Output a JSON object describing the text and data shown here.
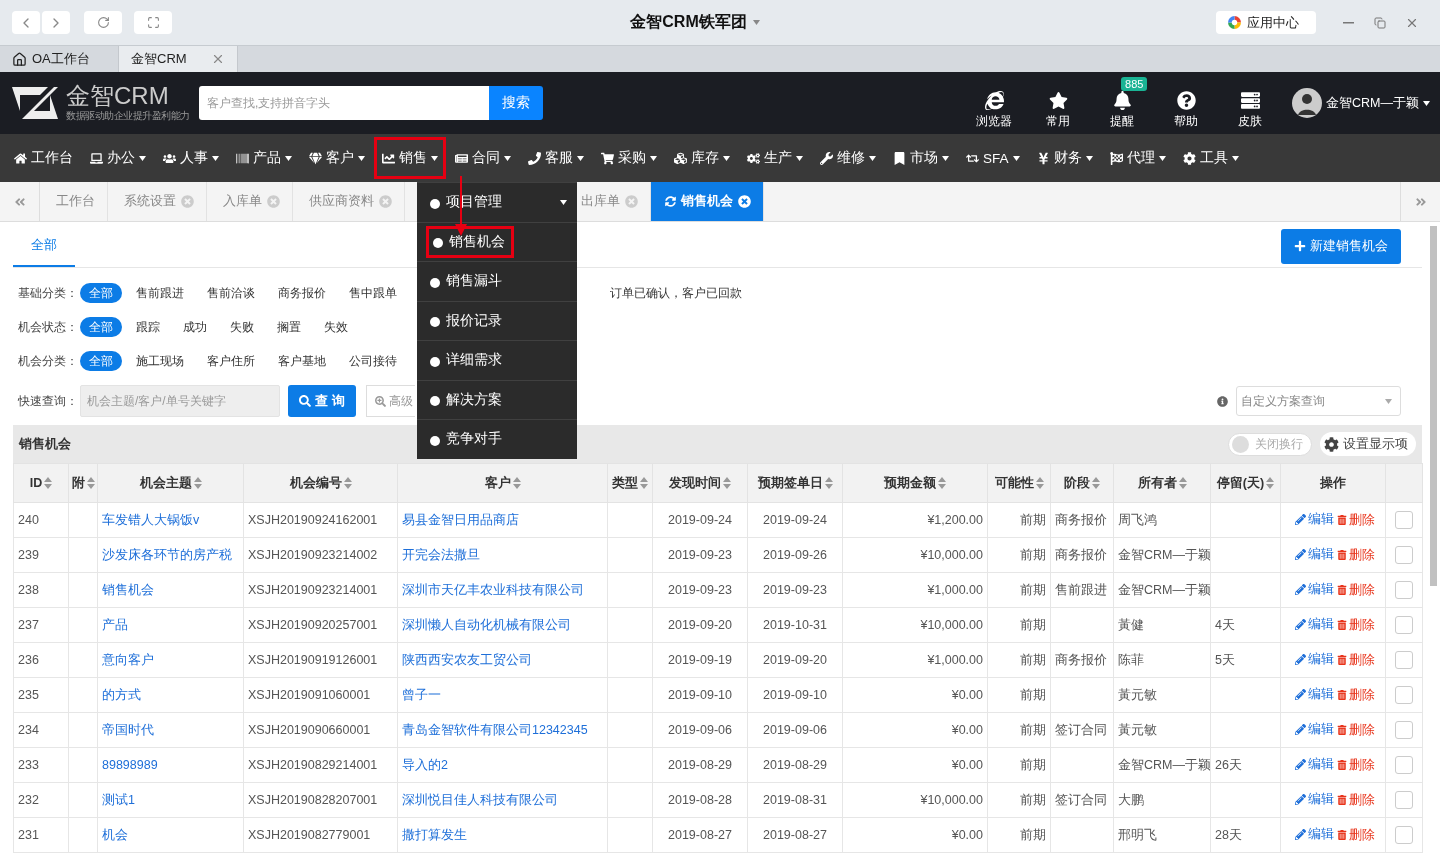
{
  "browser": {
    "title": "金智CRM铁军团",
    "app_center": "应用中心"
  },
  "app_tabs": [
    {
      "label": "OA工作台",
      "selected": false
    },
    {
      "label": "金智CRM",
      "selected": true
    }
  ],
  "header": {
    "logo": "金智CRM",
    "slogan": "数据驱动助企业提升盈利能力",
    "search": {
      "placeholder": "客户查找,支持拼音字头",
      "button": "搜索"
    },
    "tools": [
      {
        "label": "浏览器"
      },
      {
        "label": "常用"
      },
      {
        "label": "提醒",
        "badge": "885"
      },
      {
        "label": "帮助"
      },
      {
        "label": "皮肤"
      }
    ],
    "user": "金智CRM—于颖"
  },
  "nav": [
    {
      "label": "工作台",
      "dropdown": false,
      "highlighted": false
    },
    {
      "label": "办公",
      "dropdown": true,
      "highlighted": false
    },
    {
      "label": "人事",
      "dropdown": true,
      "highlighted": false
    },
    {
      "label": "产品",
      "dropdown": true,
      "highlighted": false
    },
    {
      "label": "客户",
      "dropdown": true,
      "highlighted": false
    },
    {
      "label": "销售",
      "dropdown": true,
      "highlighted": true
    },
    {
      "label": "合同",
      "dropdown": true,
      "highlighted": false
    },
    {
      "label": "客服",
      "dropdown": true,
      "highlighted": false
    },
    {
      "label": "采购",
      "dropdown": true,
      "highlighted": false
    },
    {
      "label": "库存",
      "dropdown": true,
      "highlighted": false
    },
    {
      "label": "生产",
      "dropdown": true,
      "highlighted": false
    },
    {
      "label": "维修",
      "dropdown": true,
      "highlighted": false
    },
    {
      "label": "市场",
      "dropdown": true,
      "highlighted": false
    },
    {
      "label": "SFA",
      "dropdown": true,
      "highlighted": false
    },
    {
      "label": "财务",
      "dropdown": true,
      "highlighted": false
    },
    {
      "label": "代理",
      "dropdown": true,
      "highlighted": false
    },
    {
      "label": "工具",
      "dropdown": true,
      "highlighted": false
    }
  ],
  "menu": [
    {
      "label": "项目管理",
      "submenu": true,
      "highlighted": false
    },
    {
      "label": "销售机会",
      "submenu": false,
      "highlighted": true
    },
    {
      "label": "销售漏斗",
      "submenu": false,
      "highlighted": false
    },
    {
      "label": "报价记录",
      "submenu": false,
      "highlighted": false
    },
    {
      "label": "详细需求",
      "submenu": false,
      "highlighted": false
    },
    {
      "label": "解决方案",
      "submenu": false,
      "highlighted": false
    },
    {
      "label": "竞争对手",
      "submenu": false,
      "highlighted": false
    }
  ],
  "page_tabs": [
    {
      "label": "工作台",
      "closable": false,
      "selected": false
    },
    {
      "label": "系统设置",
      "closable": true,
      "selected": false
    },
    {
      "label": "入库单",
      "closable": true,
      "selected": false
    },
    {
      "label": "供应商资料",
      "closable": true,
      "selected": false
    },
    {
      "label": "出库单",
      "closable": true,
      "selected": false,
      "covered_before": true
    },
    {
      "label": "销售机会",
      "closable": true,
      "selected": true
    }
  ],
  "content_tabs": [
    {
      "label": "全部",
      "selected": true
    }
  ],
  "new_button": "新建销售机会",
  "filters": [
    {
      "label": "基础分类：",
      "options": [
        {
          "label": "全部",
          "selected": true
        },
        {
          "label": "售前跟进",
          "selected": false
        },
        {
          "label": "售前洽谈",
          "selected": false
        },
        {
          "label": "商务报价",
          "selected": false
        },
        {
          "label": "售中跟单",
          "selected": false
        },
        {
          "label": "订单已确认，客户已回款",
          "selected": false,
          "covered_before": true
        }
      ]
    },
    {
      "label": "机会状态：",
      "options": [
        {
          "label": "全部",
          "selected": true
        },
        {
          "label": "跟踪",
          "selected": false
        },
        {
          "label": "成功",
          "selected": false
        },
        {
          "label": "失败",
          "selected": false
        },
        {
          "label": "搁置",
          "selected": false
        },
        {
          "label": "失效",
          "selected": false
        }
      ]
    },
    {
      "label": "机会分类：",
      "options": [
        {
          "label": "全部",
          "selected": true
        },
        {
          "label": "施工现场",
          "selected": false
        },
        {
          "label": "客户住所",
          "selected": false
        },
        {
          "label": "客户基地",
          "selected": false
        },
        {
          "label": "公司接待",
          "selected": false
        }
      ]
    }
  ],
  "quick_search": {
    "label": "快速查询：",
    "placeholder": "机会主题/客户/单号关键字",
    "button": "查 询",
    "advanced": "高级",
    "scheme_placeholder": "自定义方案查询"
  },
  "panel": {
    "title": "销售机会",
    "wrap_toggle": {
      "label": "关闭换行",
      "on": false
    },
    "settings": "设置显示项"
  },
  "table": {
    "columns": [
      {
        "label": "ID",
        "kind": "plain",
        "sortable": true
      },
      {
        "label": "附",
        "kind": "plain",
        "sortable": true
      },
      {
        "label": "机会主题",
        "kind": "link",
        "sortable": true
      },
      {
        "label": "机会编号",
        "kind": "plain",
        "sortable": true
      },
      {
        "label": "客户",
        "kind": "link",
        "sortable": true
      },
      {
        "label": "类型",
        "kind": "plain",
        "sortable": true
      },
      {
        "label": "发现时间",
        "kind": "date",
        "sortable": true
      },
      {
        "label": "预期签单日",
        "kind": "date",
        "sortable": true
      },
      {
        "label": "预期金额",
        "kind": "money",
        "sortable": true
      },
      {
        "label": "可能性",
        "kind": "money",
        "sortable": true
      },
      {
        "label": "阶段",
        "kind": "plain",
        "sortable": true
      },
      {
        "label": "所有者",
        "kind": "plain",
        "sortable": true
      },
      {
        "label": "停留(天)",
        "kind": "plain",
        "sortable": true
      },
      {
        "label": "操作",
        "kind": "plain",
        "sortable": false
      }
    ],
    "rows": [
      {
        "cells": [
          "240",
          null,
          "车发错人大锅饭v",
          "XSJH20190924162001",
          "易县金智日用品商店",
          null,
          "2019-09-24",
          "2019-09-24",
          "¥1,200.00",
          "前期",
          "商务报价",
          "周飞鸿",
          null
        ],
        "actions": [
          "编辑",
          "删除"
        ],
        "checked": false
      },
      {
        "cells": [
          "239",
          null,
          "沙发床各环节的房产税",
          "XSJH20190923214002",
          "开完会法撒旦",
          null,
          "2019-09-23",
          "2019-09-26",
          "¥10,000.00",
          "前期",
          "商务报价",
          "金智CRM—于颖",
          null
        ],
        "actions": [
          "编辑",
          "删除"
        ],
        "checked": false
      },
      {
        "cells": [
          "238",
          null,
          "销售机会",
          "XSJH20190923214001",
          "深圳市天亿丰农业科技有限公司",
          null,
          "2019-09-23",
          "2019-09-23",
          "¥1,000.00",
          "前期",
          "售前跟进",
          "金智CRM—于颖",
          null
        ],
        "actions": [
          "编辑",
          "删除"
        ],
        "checked": false
      },
      {
        "cells": [
          "237",
          null,
          "产品",
          "XSJH20190920257001",
          "深圳懒人自动化机械有限公司",
          null,
          "2019-09-20",
          "2019-10-31",
          "¥10,000.00",
          "前期",
          null,
          "黃健",
          "4天"
        ],
        "actions": [
          "编辑",
          "删除"
        ],
        "checked": false
      },
      {
        "cells": [
          "236",
          null,
          "意向客户",
          "XSJH20190919126001",
          "陕西西安农友工贸公司",
          null,
          "2019-09-19",
          "2019-09-20",
          "¥1,000.00",
          "前期",
          "商务报价",
          "陈菲",
          "5天"
        ],
        "actions": [
          "编辑",
          "删除"
        ],
        "checked": false
      },
      {
        "cells": [
          "235",
          null,
          "的方式",
          "XSJH2019091060001",
          "曾子一",
          null,
          "2019-09-10",
          "2019-09-10",
          "¥0.00",
          "前期",
          null,
          "黃元敏",
          null
        ],
        "actions": [
          "编辑",
          "删除"
        ],
        "checked": false
      },
      {
        "cells": [
          "234",
          null,
          "帝国时代",
          "XSJH2019090660001",
          "青岛金智软件有限公司12342345",
          null,
          "2019-09-06",
          "2019-09-06",
          "¥0.00",
          "前期",
          "签订合同",
          "黃元敏",
          null
        ],
        "actions": [
          "编辑",
          "删除"
        ],
        "checked": false
      },
      {
        "cells": [
          "233",
          null,
          "89898989",
          "XSJH20190829214001",
          "导入的2",
          null,
          "2019-08-29",
          "2019-08-29",
          "¥0.00",
          "前期",
          null,
          "金智CRM—于颖",
          "26天"
        ],
        "actions": [
          "编辑",
          "删除"
        ],
        "checked": false
      },
      {
        "cells": [
          "232",
          null,
          "测试1",
          "XSJH20190828207001",
          "深圳悦目佳人科技有限公司",
          null,
          "2019-08-28",
          "2019-08-31",
          "¥10,000.00",
          "前期",
          "签订合同",
          "大鹏",
          null
        ],
        "actions": [
          "编辑",
          "删除"
        ],
        "checked": false
      },
      {
        "cells": [
          "231",
          null,
          "机会",
          "XSJH2019082779001",
          "撒打算发生",
          null,
          "2019-08-27",
          "2019-08-27",
          "¥0.00",
          "前期",
          null,
          "邢明飞",
          "28天"
        ],
        "actions": [
          "编辑",
          "删除"
        ],
        "checked": false
      }
    ]
  }
}
